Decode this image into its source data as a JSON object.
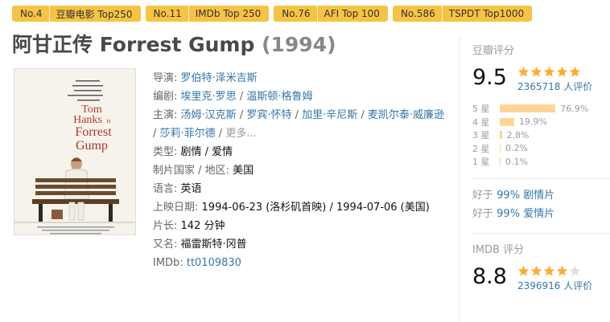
{
  "badges": [
    {
      "rank": "No.4",
      "name": "豆瓣电影 Top250"
    },
    {
      "rank": "No.11",
      "name": "IMDb Top 250"
    },
    {
      "rank": "No.76",
      "name": "AFI Top 100"
    },
    {
      "rank": "No.586",
      "name": "TSPDT Top1000"
    }
  ],
  "title": {
    "main": "阿甘正传 Forrest Gump",
    "year": "(1994)"
  },
  "poster": {
    "line1": "Tom",
    "line2": "Hanks",
    "line3": "is",
    "line4": "Forrest",
    "line5": "Gump"
  },
  "info": {
    "director_label": "导演:",
    "director": "罗伯特·泽米吉斯",
    "writer_label": "编剧:",
    "writers": [
      "埃里克·罗思",
      "温斯顿·格鲁姆"
    ],
    "cast_label": "主演:",
    "cast": [
      "汤姆·汉克斯",
      "罗宾·怀特",
      "加里·辛尼斯",
      "麦凯尔泰·威廉逊",
      "莎莉·菲尔德"
    ],
    "cast_more": "更多...",
    "genre_label": "类型:",
    "genre": "剧情 / 爱情",
    "country_label": "制片国家 / 地区:",
    "country": "美国",
    "language_label": "语言:",
    "language": "英语",
    "release_label": "上映日期:",
    "release": "1994-06-23 (洛杉矶首映) / 1994-07-06 (美国)",
    "runtime_label": "片长:",
    "runtime": "142 分钟",
    "aka_label": "又名:",
    "aka": "福雷斯特·冈普",
    "imdb_label": "IMDb:",
    "imdb_id": "tt0109830"
  },
  "douban": {
    "title": "豆瓣评分",
    "score": "9.5",
    "stars": 5,
    "votes": "2365718 人评价",
    "distribution": [
      {
        "label": "5 星",
        "pct": "76.9%",
        "value": 76.9
      },
      {
        "label": "4 星",
        "pct": "19.9%",
        "value": 19.9
      },
      {
        "label": "3 星",
        "pct": "2.8%",
        "value": 2.8
      },
      {
        "label": "2 星",
        "pct": "0.2%",
        "value": 0.2
      },
      {
        "label": "1 星",
        "pct": "0.1%",
        "value": 0.1
      }
    ],
    "better_than": [
      {
        "prefix": "好于",
        "pct": "99%",
        "genre": "剧情片"
      },
      {
        "prefix": "好于",
        "pct": "99%",
        "genre": "爱情片"
      }
    ]
  },
  "imdb": {
    "title": "IMDB 评分",
    "score": "8.8",
    "stars": 4,
    "votes": "2396916 人评价"
  },
  "colors": {
    "badge": "#f6c343",
    "link": "#3377aa",
    "star": "#ffac2d",
    "bar": "#ffd596"
  }
}
